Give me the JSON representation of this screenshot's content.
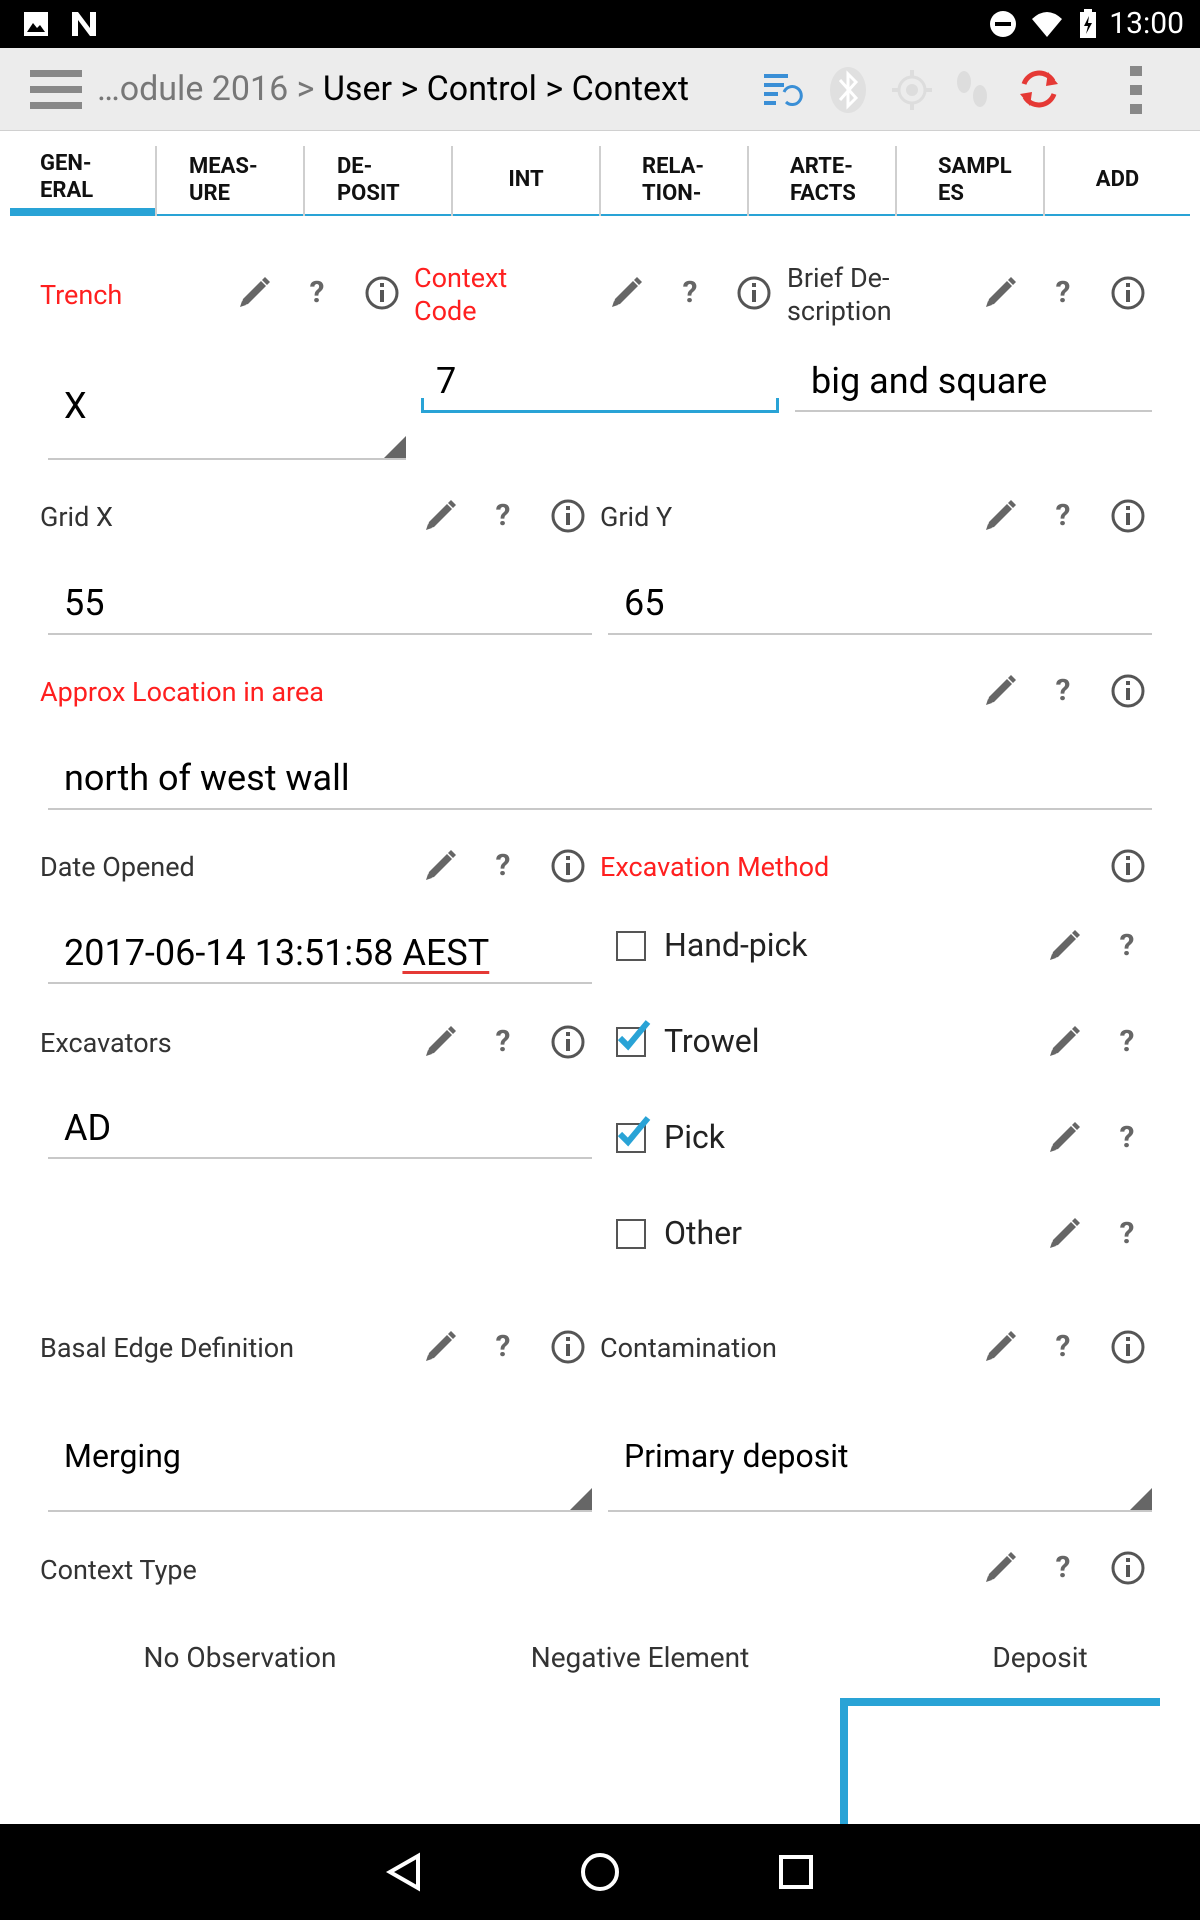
{
  "status_bar": {
    "time": "13:00"
  },
  "breadcrumb": {
    "prefix": "…odule 2016 > ",
    "path": "User > Control > Context"
  },
  "tabs": [
    {
      "label": "GEN-\nERAL"
    },
    {
      "label": "MEAS-\nURE"
    },
    {
      "label": "DE-\nPOSIT"
    },
    {
      "label": "INT"
    },
    {
      "label": "RELA-\nTION-"
    },
    {
      "label": "ARTE-\nFACTS"
    },
    {
      "label": "SAMPL\nES"
    },
    {
      "label": "ADD"
    }
  ],
  "fields": {
    "trench": {
      "label": "Trench",
      "value": "X"
    },
    "context_code": {
      "label": "Context\nCode",
      "value": "7"
    },
    "brief_description": {
      "label": "Brief De-\nscription",
      "value": "big and square"
    },
    "grid_x": {
      "label": "Grid X",
      "value": "55"
    },
    "grid_y": {
      "label": "Grid Y",
      "value": "65"
    },
    "approx_location": {
      "label": "Approx Location in area",
      "value": "north of west wall"
    },
    "date_opened": {
      "label": "Date Opened",
      "value_main": "2017-06-14 13:51:58 ",
      "value_tz": "AEST"
    },
    "excavation_method": {
      "label": "Excavation Method",
      "options": [
        {
          "label": "Hand-pick",
          "checked": false
        },
        {
          "label": "Trowel",
          "checked": true
        },
        {
          "label": "Pick",
          "checked": true
        },
        {
          "label": "Other",
          "checked": false
        }
      ]
    },
    "excavators": {
      "label": "Excavators",
      "value": "AD"
    },
    "basal_edge": {
      "label": "Basal Edge Definition",
      "value": "Merging"
    },
    "contamination": {
      "label": "Contamination",
      "value": "Primary deposit"
    },
    "context_type": {
      "label": "Context Type",
      "options": [
        "No Observation",
        "Negative Element",
        "Deposit"
      ]
    }
  },
  "colors": {
    "accent": "#29a3d6",
    "required": "#ff1f1f",
    "sync": "#e53935"
  }
}
